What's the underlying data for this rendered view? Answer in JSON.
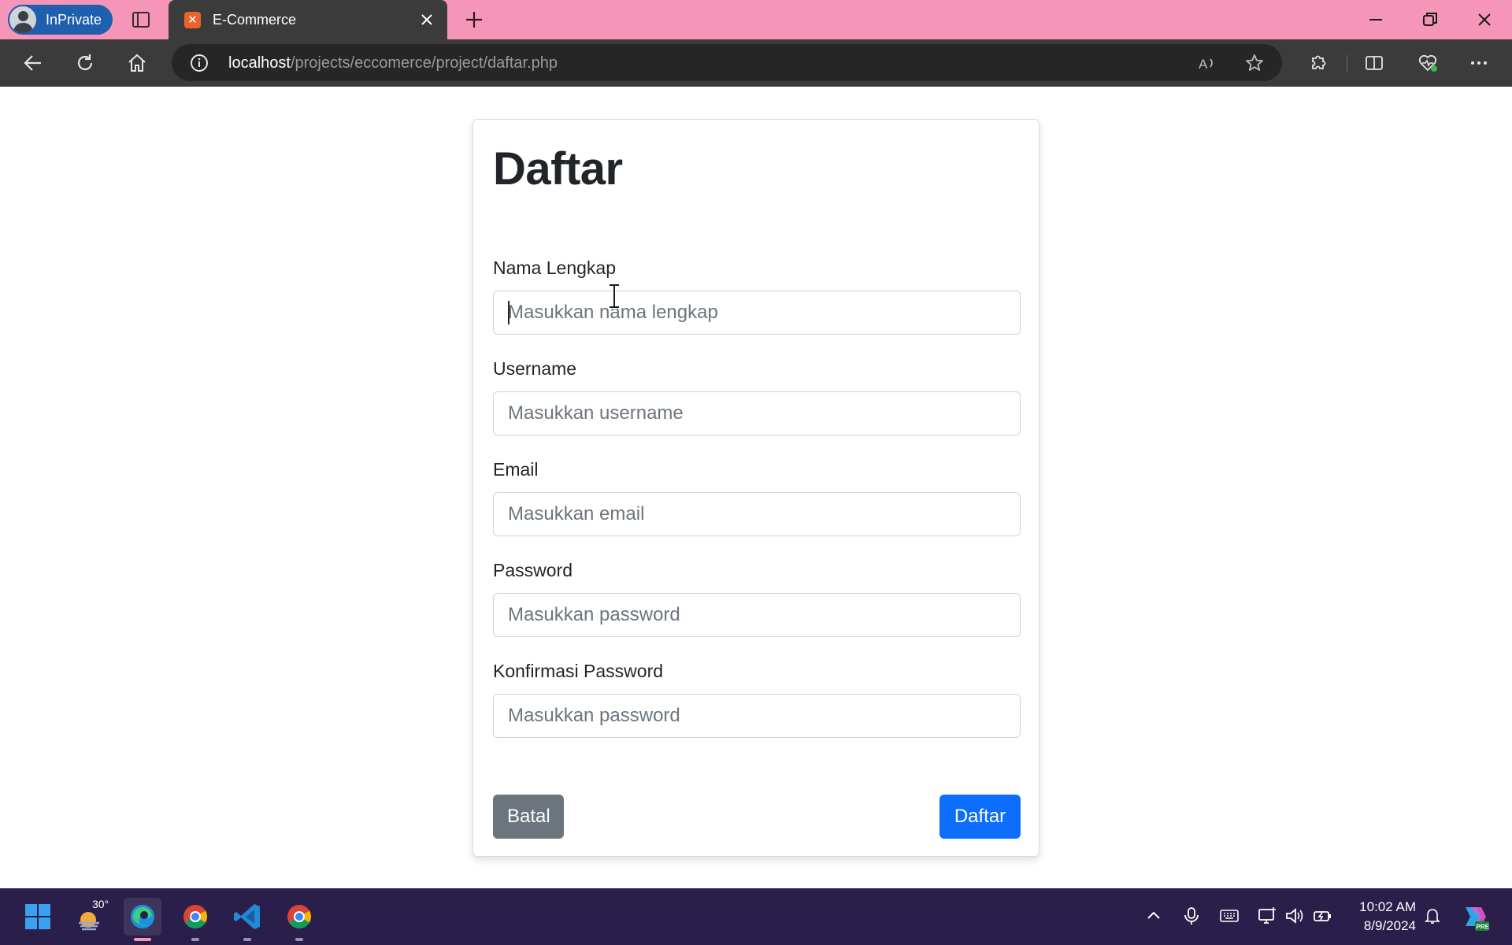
{
  "browser": {
    "profile_label": "InPrivate",
    "tab_title": "E-Commerce",
    "url_host": "localhost",
    "url_path": "/projects/eccomerce/project/daftar.php"
  },
  "form": {
    "title": "Daftar",
    "fields": [
      {
        "label": "Nama Lengkap",
        "placeholder": "Masukkan nama lengkap",
        "value": ""
      },
      {
        "label": "Username",
        "placeholder": "Masukkan username",
        "value": ""
      },
      {
        "label": "Email",
        "placeholder": "Masukkan email",
        "value": ""
      },
      {
        "label": "Password",
        "placeholder": "Masukkan password",
        "value": ""
      },
      {
        "label": "Konfirmasi Password",
        "placeholder": "Masukkan password",
        "value": ""
      }
    ],
    "cancel_label": "Batal",
    "submit_label": "Daftar"
  },
  "taskbar": {
    "weather_temp": "30°",
    "time": "10:02 AM",
    "date": "8/9/2024",
    "apps": [
      "start-icon",
      "weather-icon",
      "edge-icon",
      "chrome-icon",
      "vscode-icon",
      "chrome-icon"
    ]
  },
  "colors": {
    "titlebar": "#f596b8",
    "toolbar": "#3b3b3b",
    "primary": "#0d6efd",
    "secondary": "#6c757d",
    "taskbar": "#2a1f4a"
  }
}
